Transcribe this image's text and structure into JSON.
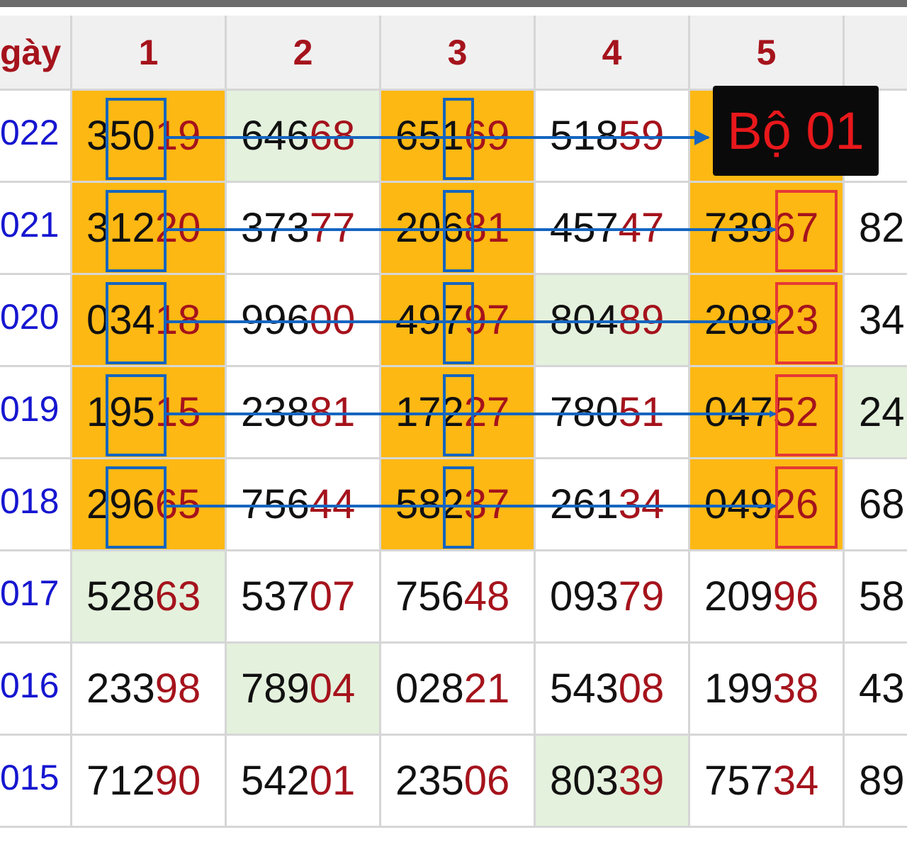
{
  "header": {
    "date_label": "gày",
    "columns": [
      "1",
      "2",
      "3",
      "4",
      "5"
    ]
  },
  "rows": [
    {
      "label": "022",
      "cells": [
        {
          "p": "350",
          "s": "19",
          "bg": "y"
        },
        {
          "p": "646",
          "s": "68",
          "bg": "g"
        },
        {
          "p": "651",
          "s": "69",
          "bg": "y"
        },
        {
          "p": "518",
          "s": "59",
          "bg": "w"
        },
        {
          "p": "",
          "s": "",
          "bg": "y"
        }
      ],
      "extra": ""
    },
    {
      "label": "021",
      "cells": [
        {
          "p": "312",
          "s": "20",
          "bg": "y"
        },
        {
          "p": "373",
          "s": "77",
          "bg": "w"
        },
        {
          "p": "206",
          "s": "81",
          "bg": "y"
        },
        {
          "p": "457",
          "s": "47",
          "bg": "w"
        },
        {
          "p": "739",
          "s": "67",
          "bg": "y"
        }
      ],
      "extra": "82"
    },
    {
      "label": "020",
      "cells": [
        {
          "p": "034",
          "s": "18",
          "bg": "y"
        },
        {
          "p": "996",
          "s": "00",
          "bg": "w"
        },
        {
          "p": "497",
          "s": "97",
          "bg": "y"
        },
        {
          "p": "804",
          "s": "89",
          "bg": "g"
        },
        {
          "p": "208",
          "s": "23",
          "bg": "y"
        }
      ],
      "extra": "34"
    },
    {
      "label": "019",
      "cells": [
        {
          "p": "195",
          "s": "15",
          "bg": "y"
        },
        {
          "p": "238",
          "s": "81",
          "bg": "w"
        },
        {
          "p": "172",
          "s": "27",
          "bg": "y"
        },
        {
          "p": "780",
          "s": "51",
          "bg": "w"
        },
        {
          "p": "047",
          "s": "52",
          "bg": "y"
        }
      ],
      "extra": "24"
    },
    {
      "label": "018",
      "cells": [
        {
          "p": "296",
          "s": "65",
          "bg": "y"
        },
        {
          "p": "756",
          "s": "44",
          "bg": "w"
        },
        {
          "p": "582",
          "s": "37",
          "bg": "y"
        },
        {
          "p": "261",
          "s": "34",
          "bg": "w"
        },
        {
          "p": "049",
          "s": "26",
          "bg": "y"
        }
      ],
      "extra": "68"
    },
    {
      "label": "017",
      "cells": [
        {
          "p": "528",
          "s": "63",
          "bg": "g"
        },
        {
          "p": "537",
          "s": "07",
          "bg": "w"
        },
        {
          "p": "756",
          "s": "48",
          "bg": "w"
        },
        {
          "p": "093",
          "s": "79",
          "bg": "w"
        },
        {
          "p": "209",
          "s": "96",
          "bg": "w"
        }
      ],
      "extra": "58"
    },
    {
      "label": "016",
      "cells": [
        {
          "p": "233",
          "s": "98",
          "bg": "w"
        },
        {
          "p": "789",
          "s": "04",
          "bg": "g"
        },
        {
          "p": "028",
          "s": "21",
          "bg": "w"
        },
        {
          "p": "543",
          "s": "08",
          "bg": "w"
        },
        {
          "p": "199",
          "s": "38",
          "bg": "w"
        }
      ],
      "extra": "43"
    },
    {
      "label": "015",
      "cells": [
        {
          "p": "712",
          "s": "90",
          "bg": "w"
        },
        {
          "p": "542",
          "s": "01",
          "bg": "w"
        },
        {
          "p": "235",
          "s": "06",
          "bg": "w"
        },
        {
          "p": "803",
          "s": "39",
          "bg": "g"
        },
        {
          "p": "757",
          "s": "34",
          "bg": "w"
        }
      ],
      "extra": "89"
    }
  ],
  "extra_bg": [
    "w",
    "w",
    "w",
    "g",
    "w",
    "w",
    "w",
    "w"
  ],
  "badge": {
    "text": "Bộ 01"
  },
  "colors": {
    "header_text": "#a5131c",
    "date_text": "#1616d0",
    "highlight_yellow": "#fdb813",
    "highlight_green": "#e4f1dd",
    "digit_black": "#111111",
    "digit_red": "#a5131c",
    "box_blue": "#1565c0",
    "box_red": "#e53935",
    "badge_bg": "#0a0a0a",
    "badge_text": "#e8181b"
  }
}
